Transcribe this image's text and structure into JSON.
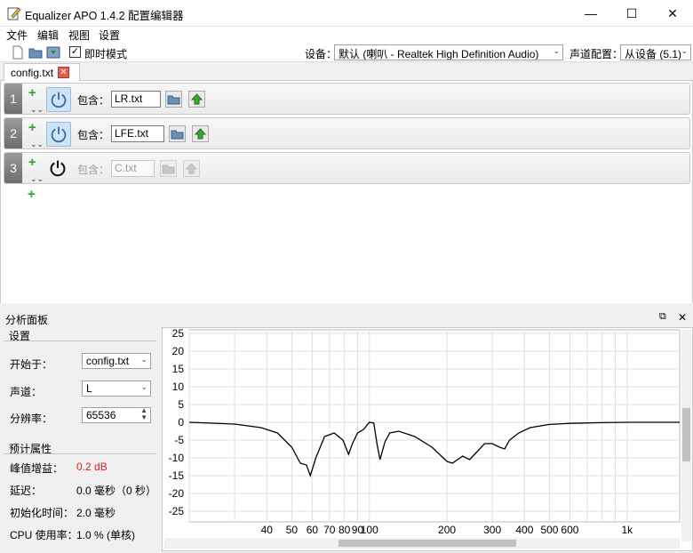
{
  "window": {
    "title": "Equalizer APO 1.4.2 配置编辑器",
    "minimize": "—",
    "maximize": "☐",
    "close": "✕"
  },
  "menu": [
    "文件",
    "编辑",
    "视图",
    "设置"
  ],
  "toolbar": {
    "instant_mode_label": "即时模式",
    "instant_mode_checked": true,
    "device_label": "设备：",
    "device_value": "默认 (喇叭 - Realtek High Definition Audio)",
    "channel_config_label": "声道配置：",
    "channel_config_value": "从设备 (5.1)"
  },
  "tab": {
    "label": "config.txt"
  },
  "rows": [
    {
      "num": "1",
      "include_label": "包含：",
      "file": "LR.txt",
      "enabled": true
    },
    {
      "num": "2",
      "include_label": "包含：",
      "file": "LFE.txt",
      "enabled": true
    },
    {
      "num": "3",
      "include_label": "包含：",
      "file": "C.txt",
      "enabled": false
    }
  ],
  "analysis": {
    "panel_title": "分析面板",
    "settings_header": "设置",
    "start_at_label": "开始于：",
    "start_at_value": "config.txt",
    "channel_label": "声道：",
    "channel_value": "L",
    "resolution_label": "分辨率：",
    "resolution_value": "65536",
    "estimated_header": "预计属性",
    "peak_gain_label": "峰值增益：",
    "peak_gain_value": "0.2 dB",
    "latency_label": "延迟：",
    "latency_value": "0.0 毫秒（0 秒）",
    "init_time_label": "初始化时间：",
    "init_time_value": "2.0 毫秒",
    "cpu_label": "CPU 使用率：",
    "cpu_value": "1.0 % (单核)",
    "colors": {
      "peak": "#e02020",
      "curve": "#000000"
    }
  },
  "chart_data": {
    "type": "line",
    "x_scale": "log",
    "xlim": [
      20,
      1600
    ],
    "ylim": [
      -28,
      26
    ],
    "y_ticks": [
      25,
      20,
      15,
      10,
      5,
      0,
      -5,
      -10,
      -15,
      -20,
      -25
    ],
    "x_tick_labels": [
      [
        "40",
        40
      ],
      [
        "50",
        50
      ],
      [
        "60",
        60
      ],
      [
        "70",
        70
      ],
      [
        "80",
        80
      ],
      [
        "90",
        90
      ],
      [
        "100",
        100
      ],
      [
        "200",
        200
      ],
      [
        "300",
        300
      ],
      [
        "400",
        400
      ],
      [
        "500",
        500
      ],
      [
        "600",
        600
      ],
      [
        "1k",
        1000
      ]
    ],
    "x_minor": [
      20,
      30,
      700,
      800,
      900
    ],
    "series": [
      {
        "x": [
          20,
          30,
          38,
          44,
          50,
          54,
          57,
          59,
          62,
          67,
          73,
          79,
          83,
          86,
          90,
          95,
          100,
          104,
          107,
          110,
          115,
          120,
          130,
          150,
          175,
          200,
          210,
          230,
          245,
          260,
          280,
          300,
          320,
          335,
          350,
          380,
          420,
          500,
          600,
          800,
          1000,
          1600
        ],
        "y": [
          0,
          -0.5,
          -1.5,
          -3,
          -7,
          -11.5,
          -12,
          -15,
          -10,
          -4,
          -3,
          -5,
          -9,
          -6,
          -3,
          -2,
          0,
          -0.2,
          -6,
          -10.5,
          -5.5,
          -3,
          -2.5,
          -4,
          -7,
          -11,
          -11.5,
          -9.5,
          -10.5,
          -8.5,
          -6,
          -6,
          -7,
          -7.5,
          -5,
          -3,
          -1.5,
          -0.6,
          -0.3,
          -0.1,
          0,
          0
        ]
      }
    ]
  }
}
